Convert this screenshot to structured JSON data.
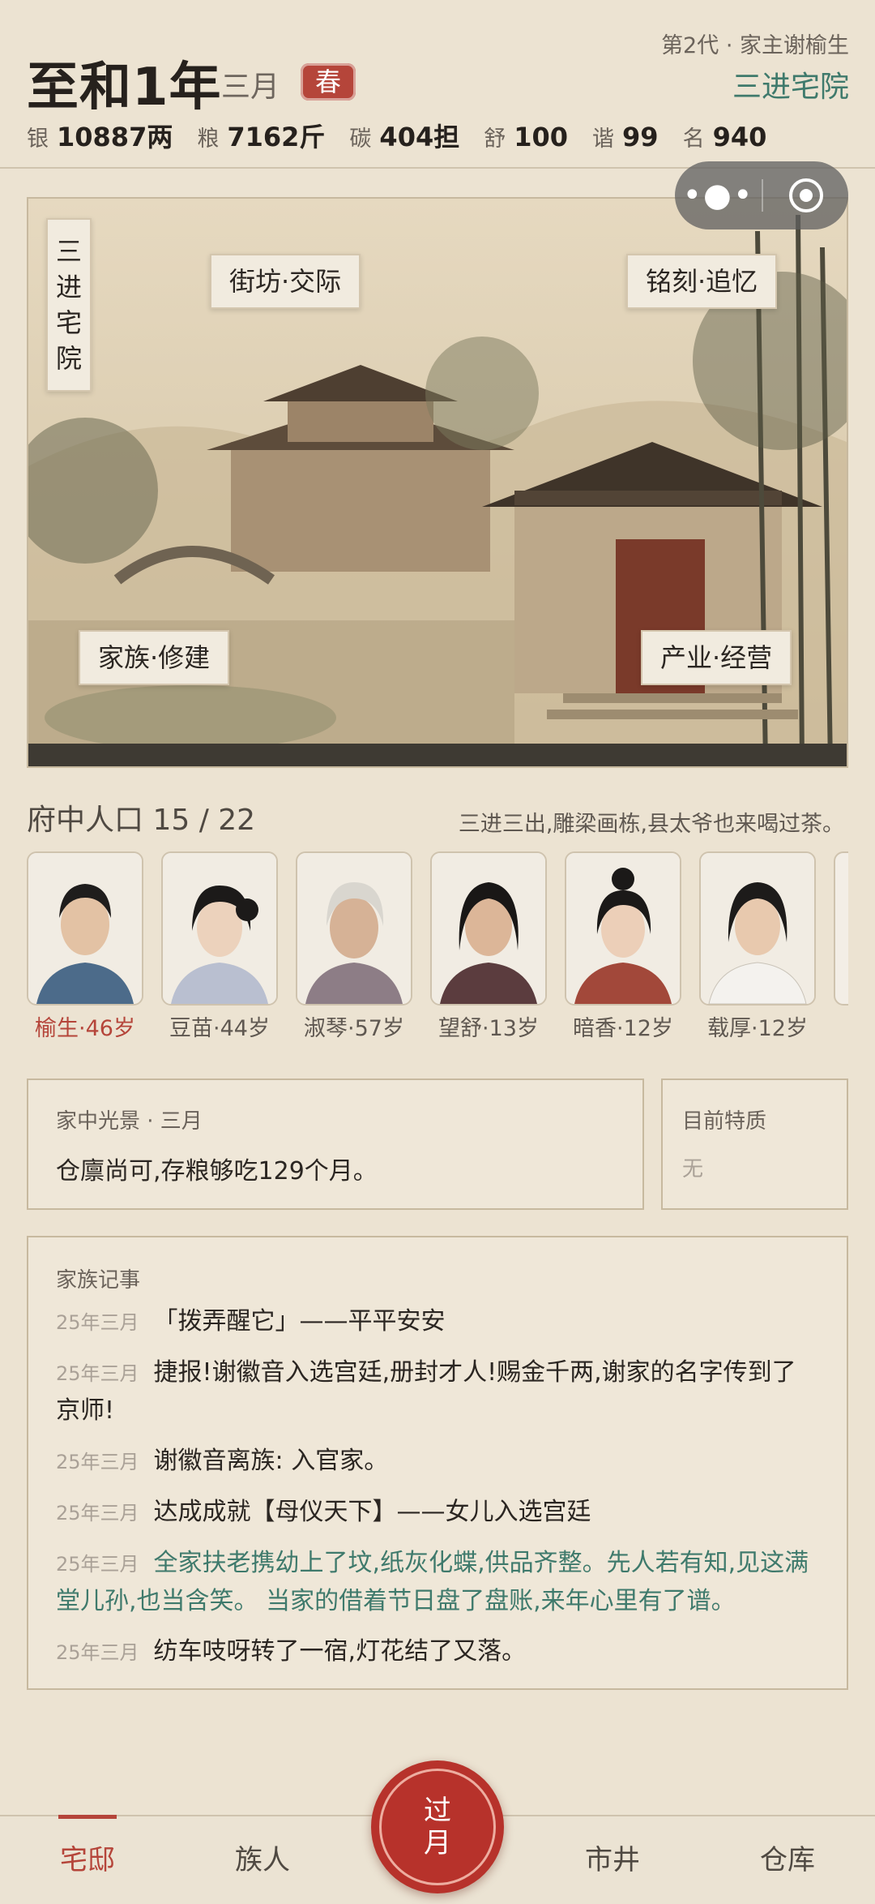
{
  "header": {
    "year": "至和1年",
    "month": "三月",
    "season": "春",
    "generation": "第2代 · 家主谢榆生",
    "residence": "三进宅院",
    "stats": [
      {
        "key": "银",
        "value": "10887两"
      },
      {
        "key": "粮",
        "value": "7162斤"
      },
      {
        "key": "碳",
        "value": "404担"
      },
      {
        "key": "舒",
        "value": "100"
      },
      {
        "key": "谐",
        "value": "99"
      },
      {
        "key": "名",
        "value": "940"
      }
    ]
  },
  "capsule": {
    "more_icon": "more-dots-icon",
    "close_icon": "target-icon"
  },
  "scene": {
    "vertical_label": [
      "三",
      "进",
      "宅",
      "院"
    ],
    "tags": {
      "street": "街坊·交际",
      "engrave": "铭刻·追忆",
      "build": "家族·修建",
      "industry": "产业·经营"
    }
  },
  "population": {
    "title": "府中人口 15 / 22",
    "description": "三进三出,雕梁画栋,县太爷也来喝过茶。",
    "members": [
      {
        "name": "榆生·46岁"
      },
      {
        "name": "豆苗·44岁"
      },
      {
        "name": "淑琴·57岁"
      },
      {
        "name": "望舒·13岁"
      },
      {
        "name": "暗香·12岁"
      },
      {
        "name": "载厚·12岁"
      }
    ]
  },
  "home": {
    "label": "家中光景 · 三月",
    "text": "仓廪尚可,存粮够吃129个月。"
  },
  "trait": {
    "label": "目前特质",
    "text": "无"
  },
  "log": {
    "label": "家族记事",
    "items": [
      {
        "date": "25年三月",
        "text": "「拨弄醒它」——平平安安"
      },
      {
        "date": "25年三月",
        "text": "捷报!谢徽音入选宫廷,册封才人!赐金千两,谢家的名字传到了京师!"
      },
      {
        "date": "25年三月",
        "text": "谢徽音离族: 入官家。"
      },
      {
        "date": "25年三月",
        "text": "达成成就【母仪天下】——女儿入选宫廷"
      },
      {
        "date": "25年三月",
        "text": "全家扶老携幼上了坟,纸灰化蝶,供品齐整。先人若有知,见这满堂儿孙,也当含笑。 当家的借着节日盘了盘账,来年心里有了谱。"
      },
      {
        "date": "25年三月",
        "text": "纺车吱呀转了一宿,灯花结了又落。"
      }
    ]
  },
  "nav": {
    "home": "宅邸",
    "clan": "族人",
    "next_top": "过",
    "next_bottom": "月",
    "market": "市井",
    "storage": "仓库"
  },
  "colors": {
    "accent": "#b5453a",
    "green": "#3f7a6c",
    "background": "#ece3d2"
  }
}
